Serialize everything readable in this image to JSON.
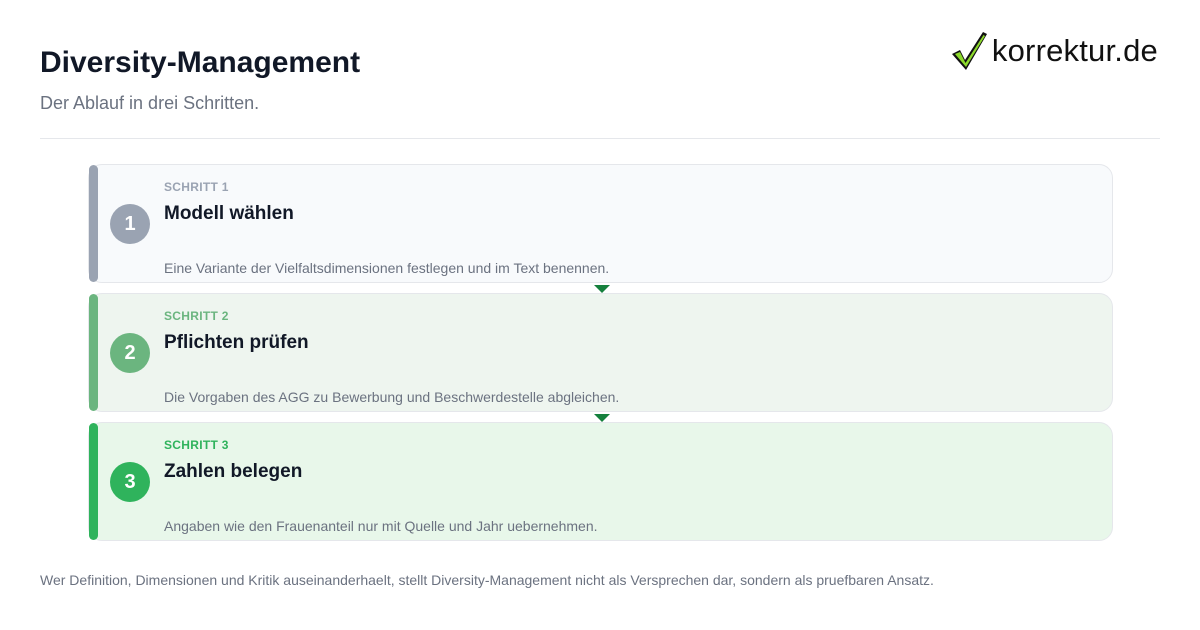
{
  "header": {
    "title": "Diversity-Management",
    "subtitle": "Der Ablauf in drei Schritten."
  },
  "logo": {
    "text": "korrektur.de",
    "icon": "checkmark-icon"
  },
  "steps": [
    {
      "number": "1",
      "label": "SCHRITT 1",
      "heading": "Modell wählen",
      "description": "Eine Variante der Vielfaltsdimensionen festlegen und im Text benennen.",
      "color": "#9aa3b2"
    },
    {
      "number": "2",
      "label": "SCHRITT 2",
      "heading": "Pflichten prüfen",
      "description": "Die Vorgaben des AGG zu Bewerbung und Beschwerdestelle abgleichen.",
      "color": "#6bb57f"
    },
    {
      "number": "3",
      "label": "SCHRITT 3",
      "heading": "Zahlen belegen",
      "description": "Angaben wie den Frauenanteil nur mit Quelle und Jahr uebernehmen.",
      "color": "#2fb35c"
    }
  ],
  "footer": {
    "text": "Wer Definition, Dimensionen und Kritik auseinanderhaelt, stellt Diversity-Management nicht als Versprechen dar, sondern als pruefbaren Ansatz."
  }
}
